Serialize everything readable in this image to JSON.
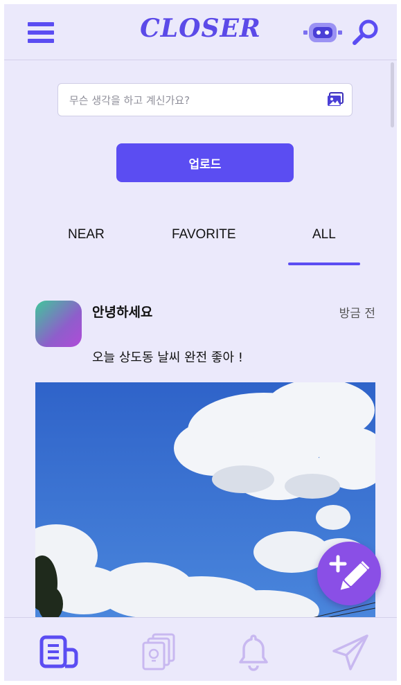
{
  "header": {
    "brand": "CLOSER",
    "menu_icon": "hamburger-menu-icon",
    "robot_icon": "robot-icon",
    "search_icon": "search-icon"
  },
  "composer": {
    "placeholder": "무슨 생각을 하고 계신가요?",
    "value": "",
    "image_icon": "image-icon",
    "upload_label": "업로드"
  },
  "tabs": [
    {
      "label": "NEAR",
      "active": false
    },
    {
      "label": "FAVORITE",
      "active": false
    },
    {
      "label": "ALL",
      "active": true
    }
  ],
  "post": {
    "author": "안녕하세요",
    "time": "방금 전",
    "text": "오늘 상도동 날씨 완전 좋아 !"
  },
  "fab": {
    "icon": "compose-icon"
  },
  "bottom_nav": [
    {
      "icon": "feed-icon",
      "active": true
    },
    {
      "icon": "idea-cards-icon",
      "active": false
    },
    {
      "icon": "bell-icon",
      "active": false
    },
    {
      "icon": "send-icon",
      "active": false
    }
  ],
  "colors": {
    "accent": "#5b4df2",
    "background": "#ebe9fb",
    "fab": "#8a4fe6",
    "inactive_icon": "#c8b8f0"
  }
}
